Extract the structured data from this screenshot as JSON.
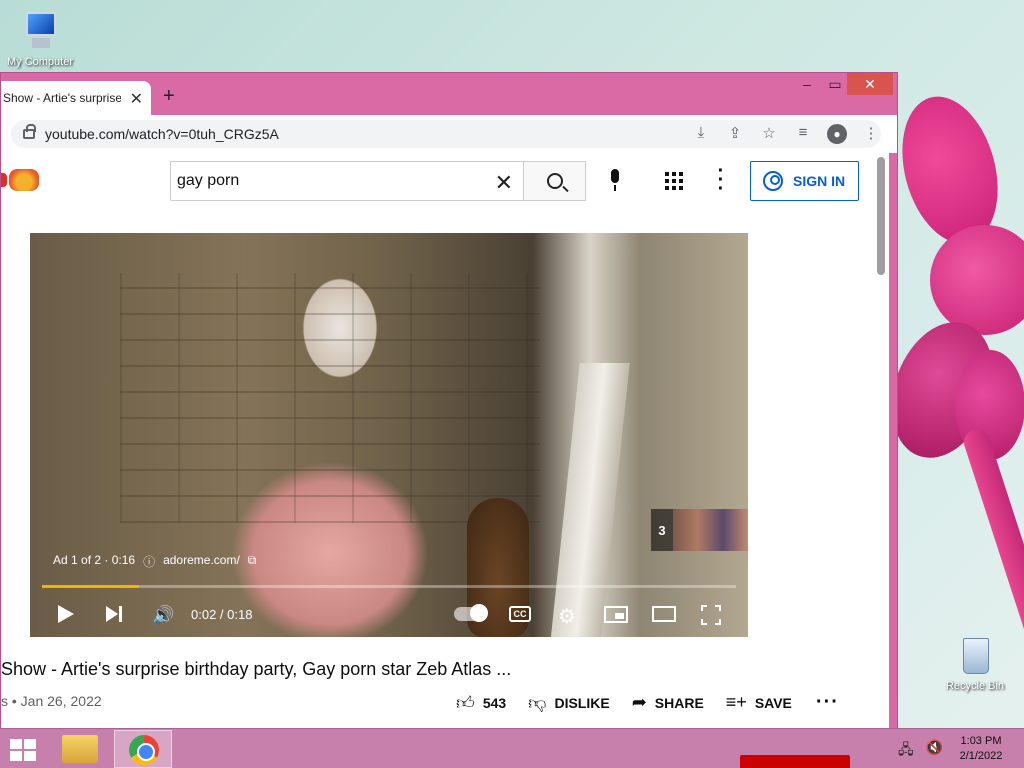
{
  "desktop": {
    "icons": [
      {
        "label": "My Computer"
      },
      {
        "label": "Recycle Bin"
      }
    ]
  },
  "browser": {
    "tab": {
      "title": "Show - Artie's surprise"
    },
    "address": {
      "url": "youtube.com/watch?v=0tuh_CRGz5A"
    }
  },
  "youtube": {
    "search": {
      "query": "gay porn"
    },
    "signin_label": "SIGN IN",
    "player": {
      "ad_label": "Ad 1 of 2 · 0:16",
      "ad_url": "adoreme.com/",
      "up_next_count": "3",
      "time": "0:02 / 0:18",
      "progress": 0.14,
      "cc_label": "CC"
    },
    "video": {
      "title": "Show - Artie's surprise birthday party, Gay porn star Zeb Atlas ...",
      "meta": "s • Jan 26, 2022",
      "likes": "543",
      "dislike_label": "DISLIKE",
      "share_label": "SHARE",
      "save_label": "SAVE"
    }
  },
  "taskbar": {
    "time": "1:03 PM",
    "date": "2/1/2022"
  },
  "colors": {
    "window_frame": "#d96aa6",
    "youtube_blue": "#065fd4",
    "progress_ad": "#f2b400"
  }
}
